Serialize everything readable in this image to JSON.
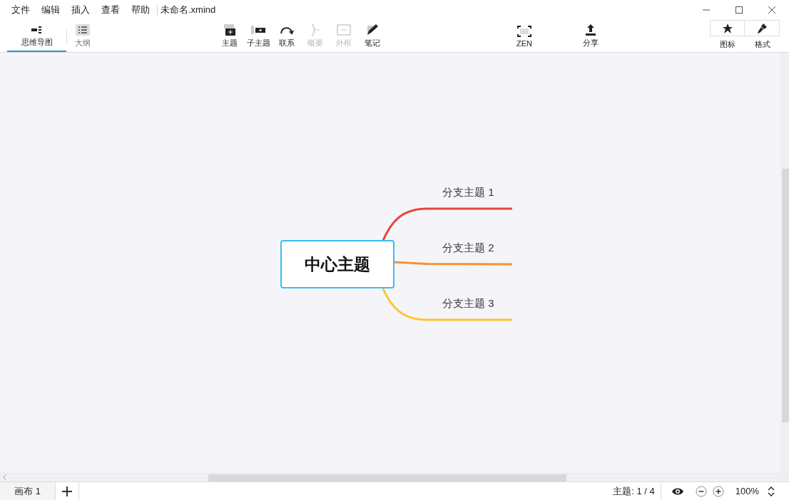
{
  "menu": [
    "文件",
    "编辑",
    "插入",
    "查看",
    "帮助"
  ],
  "window": {
    "title": "未命名.xmind"
  },
  "views": [
    {
      "label": "思维导图",
      "selected": true
    },
    {
      "label": "大纲",
      "selected": false
    }
  ],
  "tools": [
    {
      "label": "主题",
      "disabled": false
    },
    {
      "label": "子主题",
      "disabled": false
    },
    {
      "label": "联系",
      "disabled": false
    },
    {
      "label": "概要",
      "disabled": true
    },
    {
      "label": "外框",
      "disabled": true
    },
    {
      "label": "笔记",
      "disabled": false
    }
  ],
  "zen": {
    "label": "ZEN"
  },
  "share": {
    "label": "分享"
  },
  "panels": [
    {
      "label": "图标"
    },
    {
      "label": "格式"
    }
  ],
  "map": {
    "central": "中心主题",
    "branches": [
      {
        "label": "分支主题 1",
        "color": "#e8453c"
      },
      {
        "label": "分支主题 2",
        "color": "#f5932f"
      },
      {
        "label": "分支主题 3",
        "color": "#fbc634"
      }
    ]
  },
  "status_bar": {
    "sheets": [
      {
        "label": "画布 1"
      }
    ],
    "topics": "主题: 1 / 4",
    "zoom": "100%"
  }
}
